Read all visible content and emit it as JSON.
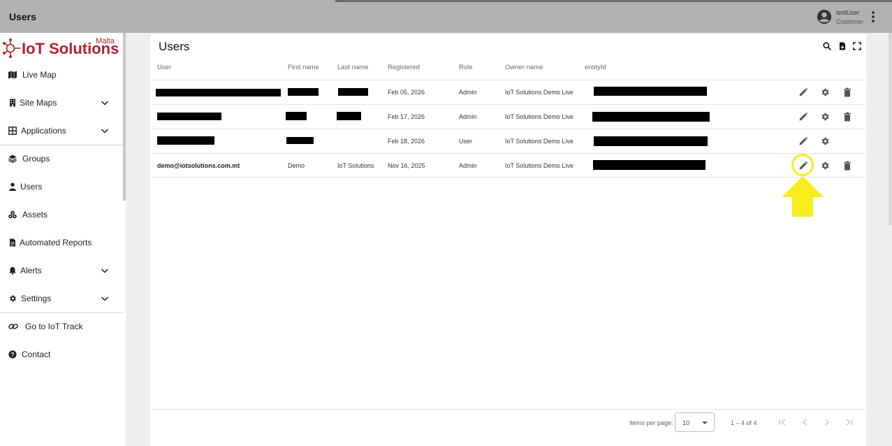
{
  "header": {
    "title": "Users",
    "user_name": "testUser",
    "user_role": "Customer"
  },
  "brand": {
    "logo_text": "IoT Solutions",
    "logo_sub": "Malta",
    "accent": "#b2222a"
  },
  "sidebar": {
    "items": [
      {
        "label": "Live Map",
        "icon": "map-icon"
      },
      {
        "label": "Site Maps",
        "icon": "building-icon"
      },
      {
        "label": "Applications",
        "icon": "grid-icon"
      },
      {
        "label": "Groups",
        "icon": "layers-icon"
      },
      {
        "label": "Users",
        "icon": "person-icon"
      },
      {
        "label": "Assets",
        "icon": "assets-icon"
      },
      {
        "label": "Automated Reports",
        "icon": "document-icon"
      },
      {
        "label": "Alerts",
        "icon": "bell-icon"
      },
      {
        "label": "Settings",
        "icon": "gear-icon"
      },
      {
        "label": "Go to IoT Track",
        "icon": "link-icon"
      },
      {
        "label": "Contact",
        "icon": "help-icon"
      }
    ]
  },
  "main": {
    "title": "Users",
    "columns": [
      "User",
      "First name",
      "Last name",
      "Registered",
      "Role",
      "Owner name",
      "entityId"
    ],
    "rows": [
      {
        "user": "",
        "first": "",
        "last": "",
        "registered": "Feb 05, 2026",
        "role": "Admin",
        "owner": "IoT Solutions Demo Live",
        "entity": ""
      },
      {
        "user": "",
        "first": "",
        "last": "",
        "registered": "Feb 17, 2026",
        "role": "Admin",
        "owner": "IoT Solutions Demo Live",
        "entity": ""
      },
      {
        "user": "",
        "first": "",
        "last": "",
        "registered": "Feb 18, 2026",
        "role": "User",
        "owner": "IoT Solutions Demo Live",
        "entity": ""
      },
      {
        "user": "demo@iotsolutions.com.mt",
        "first": "Demo",
        "last": "IoT Solutions",
        "registered": "Nov 16, 2025",
        "role": "Admin",
        "owner": "IoT Solutions Demo Live",
        "entity": ""
      }
    ]
  },
  "paginator": {
    "items_per_page_label": "Items per page:",
    "items_per_page_value": "10",
    "range": "1 – 4 of 4"
  },
  "colors": {
    "highlight": "#f7ee1d"
  }
}
